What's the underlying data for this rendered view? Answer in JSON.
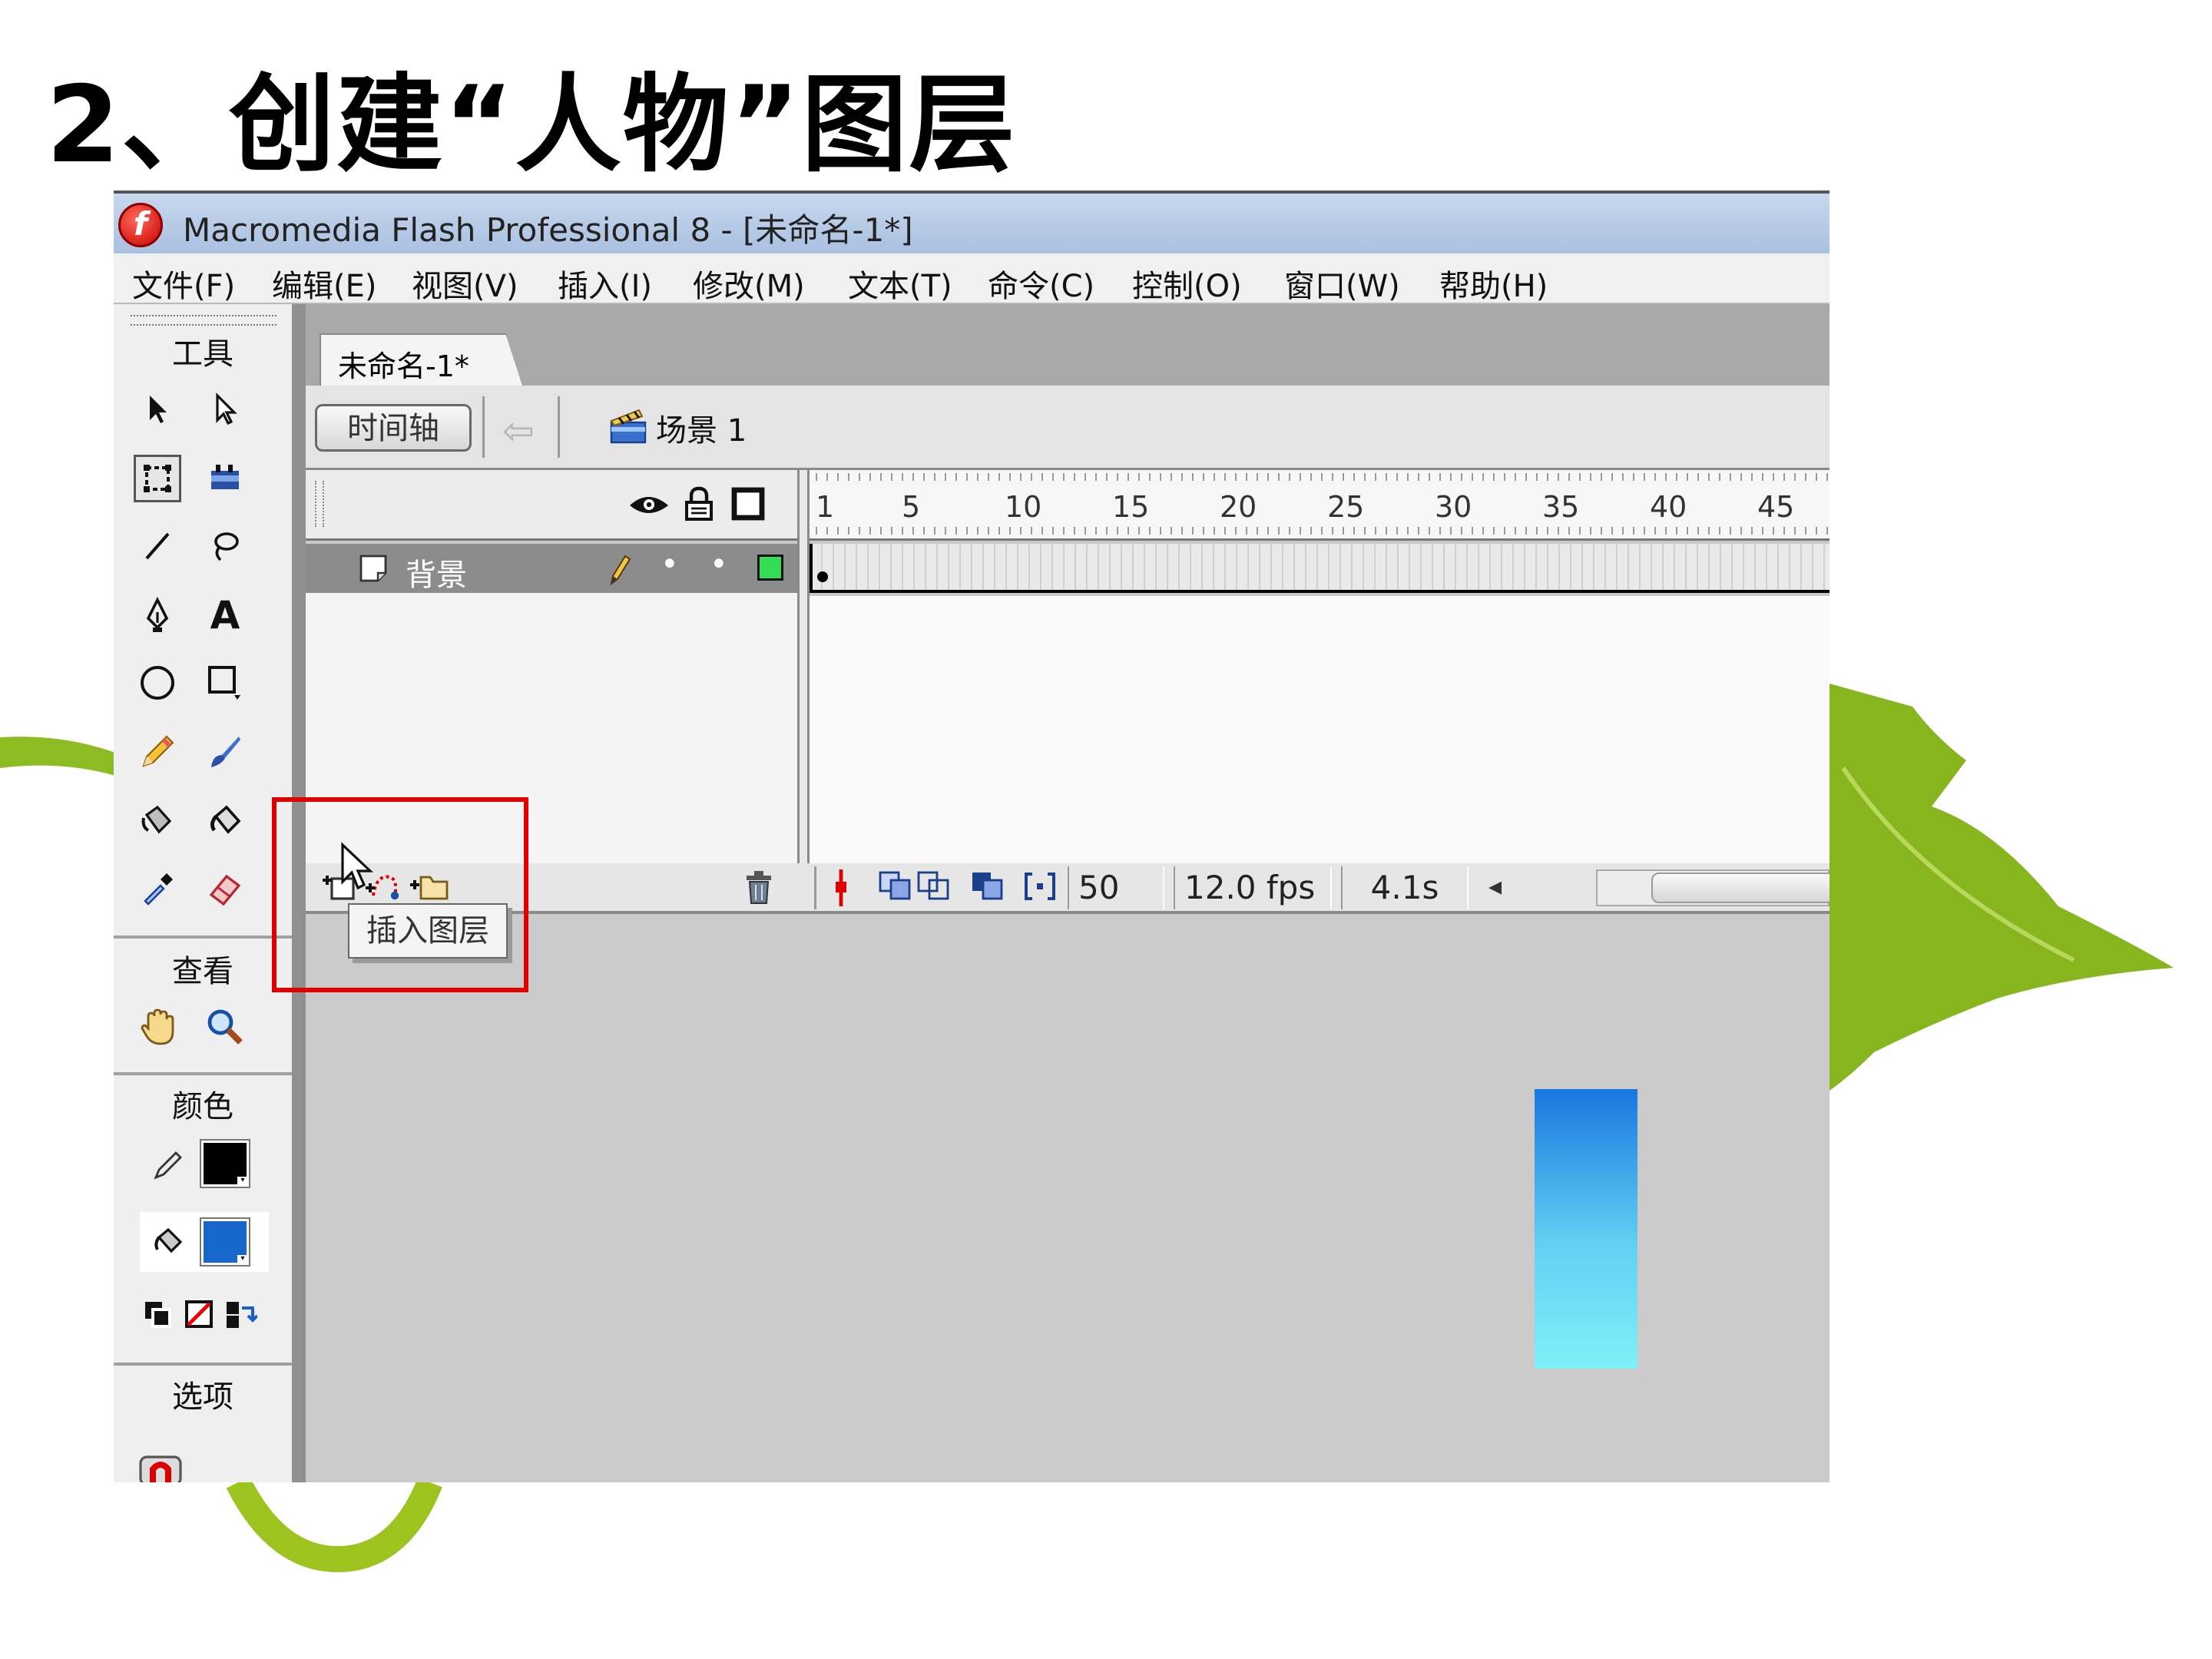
{
  "slide": {
    "title": "2、创建“人物”图层"
  },
  "window": {
    "title": "Macromedia Flash Professional 8 - [未命名-1*]",
    "app_icon_letter": "f"
  },
  "menu": [
    "文件(F)",
    "编辑(E)",
    "视图(V)",
    "插入(I)",
    "修改(M)",
    "文本(T)",
    "命令(C)",
    "控制(O)",
    "窗口(W)",
    "帮助(H)"
  ],
  "toolbox": {
    "tools_label": "工具",
    "view_label": "查看",
    "color_label": "颜色",
    "options_label": "选项",
    "text_tool_glyph": "A",
    "stroke_color": "#000000",
    "fill_color": "#1766cc"
  },
  "document": {
    "tab_label": "未命名-1*",
    "timeline_button": "时间轴",
    "scene_label": "场景 1"
  },
  "timeline": {
    "frame_numbers": [
      "1",
      "5",
      "10",
      "15",
      "20",
      "25",
      "30",
      "35",
      "40",
      "45"
    ],
    "layer": {
      "name": "背景",
      "dot1": "•",
      "dot2": "•",
      "outline_color": "#33dd55"
    },
    "current_frame": "50",
    "frame_rate": "12.0 fps",
    "elapsed_time": "4.1s",
    "scroll_left_glyph": "◂"
  },
  "tooltip": {
    "text": "插入图层"
  },
  "colors": {
    "highlight": "#e10000",
    "leaf": "#7fb31a",
    "ring": "#9dc31f"
  }
}
